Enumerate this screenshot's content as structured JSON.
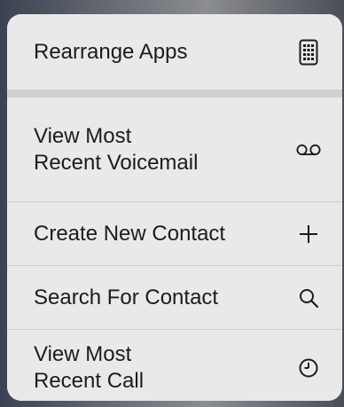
{
  "menu": {
    "items": [
      {
        "label": "Rearrange Apps",
        "icon": "phone-grid-icon"
      },
      {
        "label_line1": "View Most",
        "label_line2": "Recent Voicemail",
        "icon": "voicemail-icon"
      },
      {
        "label": "Create New Contact",
        "icon": "plus-icon"
      },
      {
        "label": "Search For Contact",
        "icon": "search-icon"
      },
      {
        "label_line1": "View Most",
        "label_line2": "Recent Call",
        "icon": "clock-icon"
      }
    ]
  }
}
